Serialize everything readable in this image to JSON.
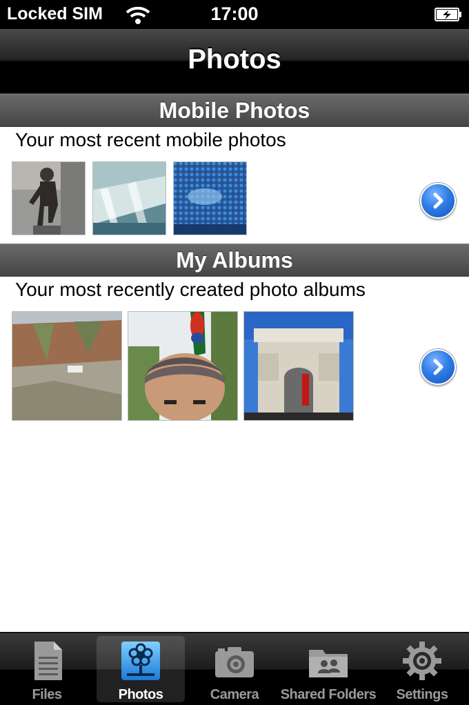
{
  "status_bar": {
    "carrier": "Locked SIM",
    "time": "17:00"
  },
  "nav": {
    "title": "Photos"
  },
  "mobile_photos": {
    "header": "Mobile Photos",
    "subtitle": "Your most recent mobile photos",
    "thumbnails": [
      "statue-photo",
      "waterfall-photo",
      "mosaic-photo"
    ]
  },
  "my_albums": {
    "header": "My Albums",
    "subtitle": "Your most recently created photo albums",
    "thumbnails": [
      "cliff-landscape-photo",
      "man-with-parrot-photo",
      "arc-de-triomphe-photo"
    ]
  },
  "tabs": [
    {
      "label": "Files",
      "icon": "document-icon",
      "active": false
    },
    {
      "label": "Photos",
      "icon": "flower-icon",
      "active": true
    },
    {
      "label": "Camera",
      "icon": "camera-icon",
      "active": false
    },
    {
      "label": "Shared Folders",
      "icon": "shared-folder-icon",
      "active": false
    },
    {
      "label": "Settings",
      "icon": "gear-icon",
      "active": false
    }
  ],
  "colors": {
    "accent_blue": "#2f7de6",
    "header_gray": "#555555",
    "bar_black": "#000000"
  }
}
